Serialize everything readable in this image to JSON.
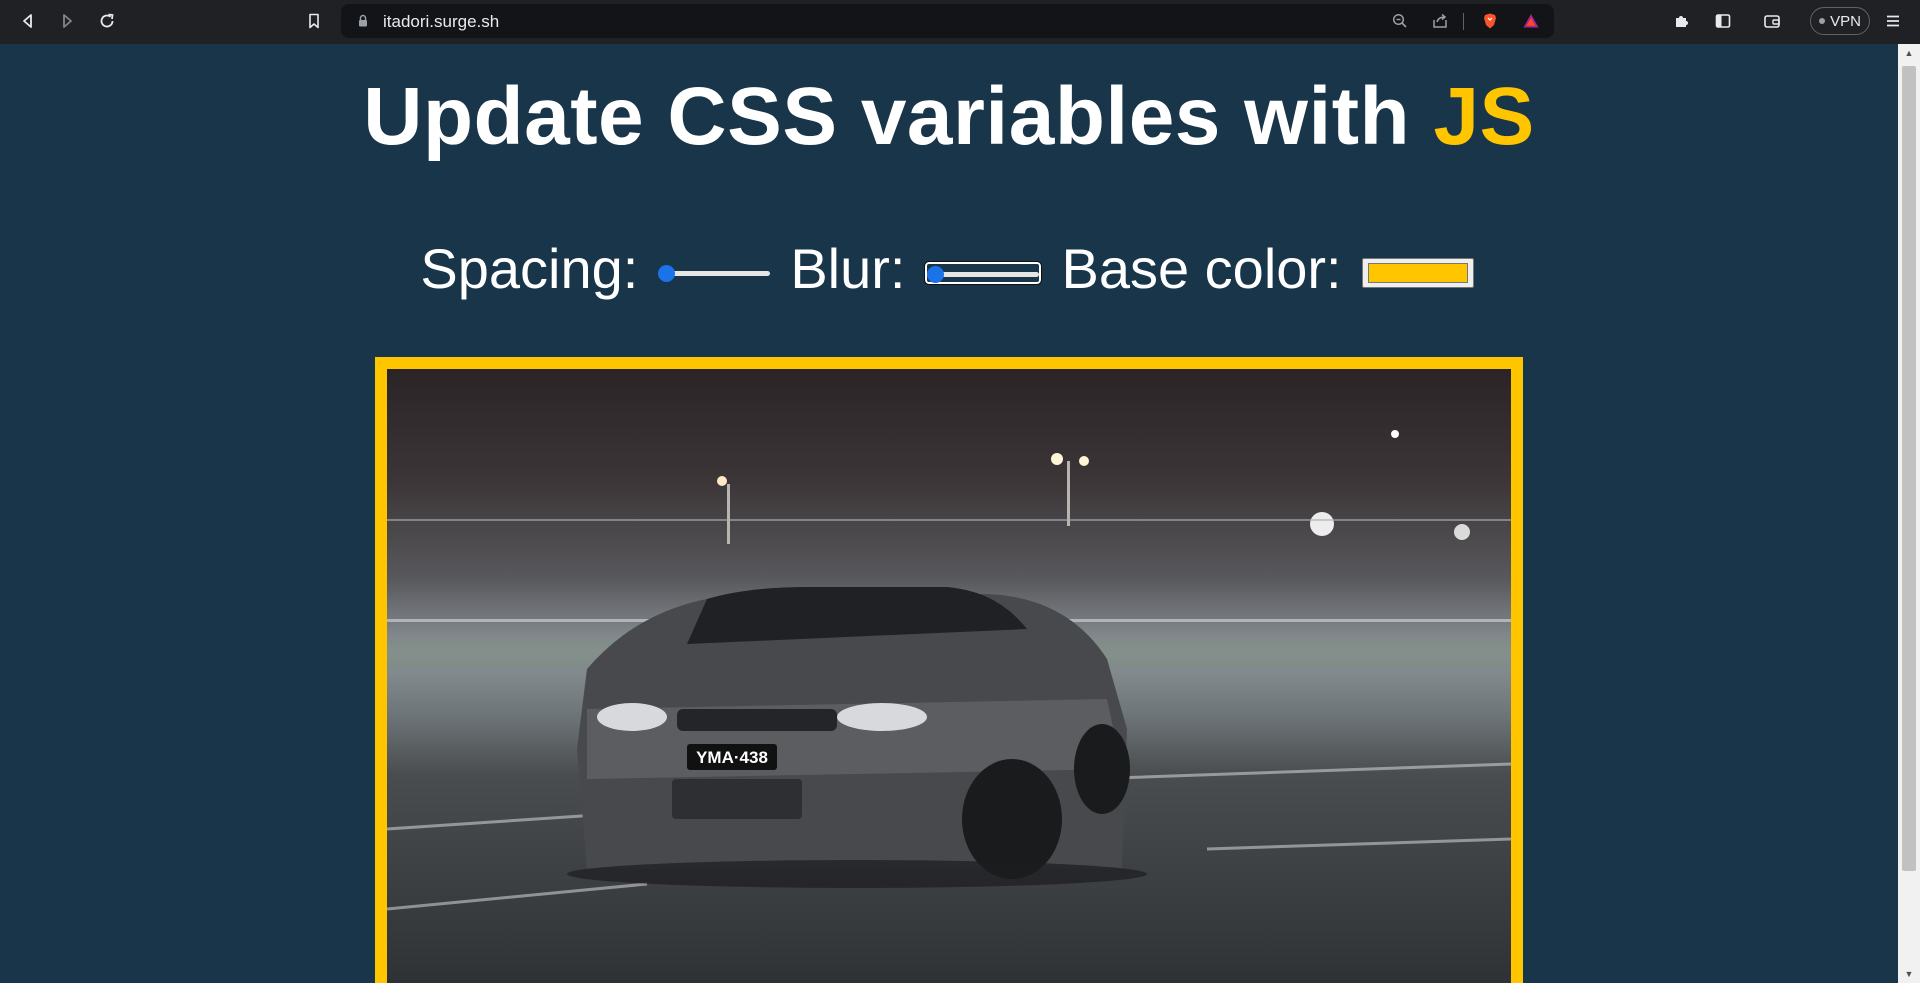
{
  "browser": {
    "url": "itadori.surge.sh",
    "vpn_label": "VPN"
  },
  "page": {
    "title_main": "Update CSS variables with ",
    "title_highlight": "JS",
    "controls": {
      "spacing_label": "Spacing:",
      "spacing_value": 0.0,
      "blur_label": "Blur:",
      "blur_value": 0.0,
      "base_color_label": "Base color:",
      "base_color_value": "#ffc600"
    },
    "photo_plate": "YMA·438"
  },
  "colors": {
    "background": "#193549",
    "accent": "#ffc600",
    "slider_blue": "#1a73e8"
  },
  "icons": [
    "back-icon",
    "forward-icon",
    "reload-icon",
    "bookmark-icon",
    "lock-icon",
    "zoom-icon",
    "share-icon",
    "brave-shield-icon",
    "brave-rewards-icon",
    "extensions-icon",
    "sidebar-icon",
    "wallet-icon",
    "menu-icon"
  ]
}
